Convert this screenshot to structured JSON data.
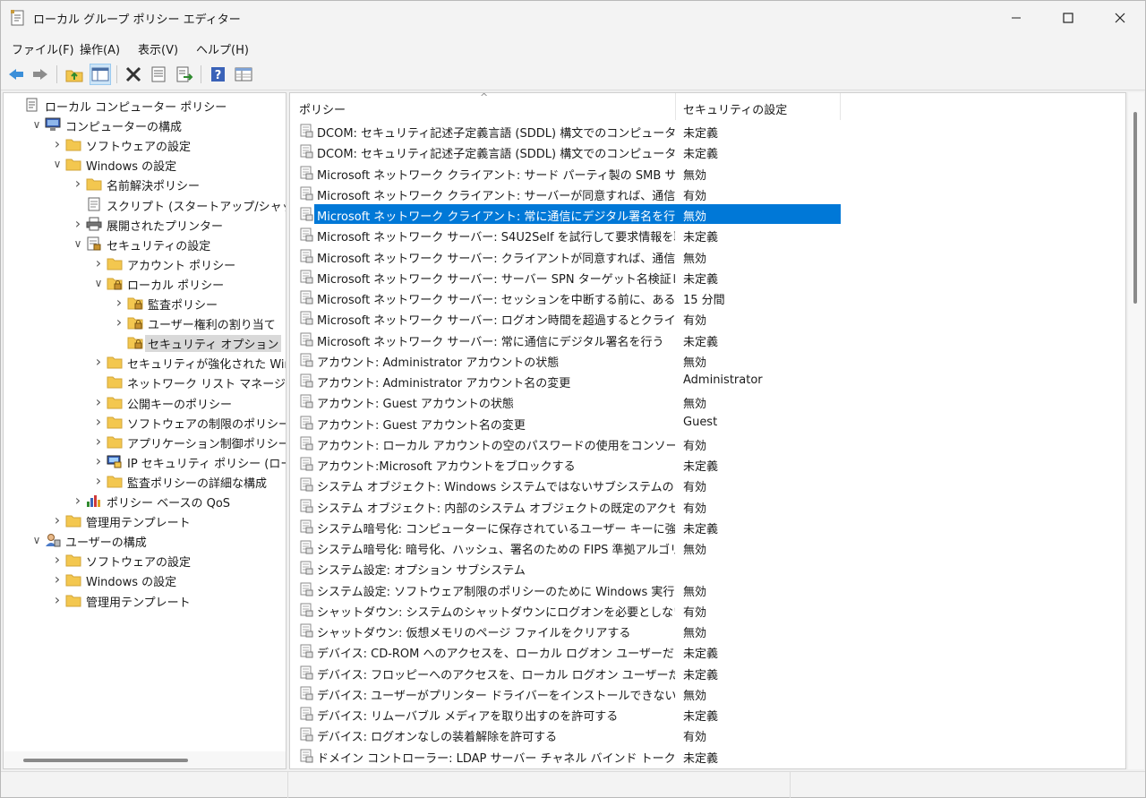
{
  "window": {
    "title": "ローカル グループ ポリシー エディター",
    "app_icon": "policy-editor-icon"
  },
  "menubar": {
    "items": [
      "ファイル(F)",
      "操作(A)",
      "表示(V)",
      "ヘルプ(H)"
    ]
  },
  "toolbar": {
    "buttons": [
      "back-icon",
      "forward-icon",
      "up-folder-icon",
      "show-hide-tree-icon",
      "delete-icon",
      "properties-icon",
      "export-list-icon",
      "help-icon",
      "details-view-icon"
    ]
  },
  "tree": {
    "nodes": [
      {
        "label": "ローカル コンピューター ポリシー",
        "icon": "policy-doc-icon"
      },
      {
        "label": "コンピューターの構成",
        "icon": "computer-icon",
        "expander": "expanded"
      },
      {
        "label": "ソフトウェアの設定",
        "icon": "folder-icon",
        "expander": "collapsed"
      },
      {
        "label": "Windows の設定",
        "icon": "folder-icon",
        "expander": "expanded"
      },
      {
        "label": "名前解決ポリシー",
        "icon": "folder-icon",
        "expander": "collapsed"
      },
      {
        "label": "スクリプト (スタートアップ/シャットダウン)",
        "icon": "script-icon"
      },
      {
        "label": "展開されたプリンター",
        "icon": "printer-icon",
        "expander": "collapsed"
      },
      {
        "label": "セキュリティの設定",
        "icon": "security-settings-icon",
        "expander": "expanded"
      },
      {
        "label": "アカウント ポリシー",
        "icon": "folder-icon",
        "expander": "collapsed"
      },
      {
        "label": "ローカル ポリシー",
        "icon": "locked-folder-icon",
        "expander": "expanded"
      },
      {
        "label": "監査ポリシー",
        "icon": "locked-folder-icon",
        "expander": "collapsed"
      },
      {
        "label": "ユーザー権利の割り当て",
        "icon": "locked-folder-icon",
        "expander": "collapsed"
      },
      {
        "label": "セキュリティ オプション",
        "icon": "locked-folder-icon",
        "selected": true
      },
      {
        "label": "セキュリティが強化された Windows",
        "icon": "folder-icon",
        "expander": "collapsed"
      },
      {
        "label": "ネットワーク リスト マネージャー ポリシ",
        "icon": "folder-icon"
      },
      {
        "label": "公開キーのポリシー",
        "icon": "folder-icon",
        "expander": "collapsed"
      },
      {
        "label": "ソフトウェアの制限のポリシー",
        "icon": "folder-icon",
        "expander": "collapsed"
      },
      {
        "label": "アプリケーション制御ポリシー",
        "icon": "folder-icon",
        "expander": "collapsed"
      },
      {
        "label": "IP セキュリティ ポリシー (ローカル コン",
        "icon": "ip-security-icon",
        "expander": "collapsed"
      },
      {
        "label": "監査ポリシーの詳細な構成",
        "icon": "folder-icon",
        "expander": "collapsed"
      },
      {
        "label": "ポリシー ベースの QoS",
        "icon": "qos-chart-icon",
        "expander": "collapsed"
      },
      {
        "label": "管理用テンプレート",
        "icon": "folder-icon",
        "expander": "collapsed"
      },
      {
        "label": "ユーザーの構成",
        "icon": "user-icon",
        "expander": "expanded"
      },
      {
        "label": "ソフトウェアの設定",
        "icon": "folder-icon",
        "expander": "collapsed"
      },
      {
        "label": "Windows の設定",
        "icon": "folder-icon",
        "expander": "collapsed"
      },
      {
        "label": "管理用テンプレート",
        "icon": "folder-icon",
        "expander": "collapsed"
      }
    ]
  },
  "list": {
    "columns": [
      "ポリシー",
      "セキュリティの設定"
    ],
    "rows": [
      {
        "policy": "DCOM: セキュリティ記述子定義言語 (SDDL) 構文でのコンピューター ...",
        "setting": "未定義"
      },
      {
        "policy": "DCOM: セキュリティ記述子定義言語 (SDDL) 構文でのコンピューター...",
        "setting": "未定義"
      },
      {
        "policy": "Microsoft ネットワーク クライアント: サード パーティ製の SMB サーバーへ...",
        "setting": "無効"
      },
      {
        "policy": "Microsoft ネットワーク クライアント: サーバーが同意すれば、通信にデ...",
        "setting": "有効"
      },
      {
        "policy": "Microsoft ネットワーク クライアント: 常に通信にデジタル署名を行う",
        "setting": "無効",
        "selected": true
      },
      {
        "policy": "Microsoft ネットワーク サーバー: S4U2Self を試行して要求情報を取...",
        "setting": "未定義"
      },
      {
        "policy": "Microsoft ネットワーク サーバー: クライアントが同意すれば、通信にデ...",
        "setting": "無効"
      },
      {
        "policy": "Microsoft ネットワーク サーバー: サーバー SPN ターゲット名検証レベル",
        "setting": "未定義"
      },
      {
        "policy": "Microsoft ネットワーク サーバー: セッションを中断する前に、ある一定...",
        "setting": "15 分間"
      },
      {
        "policy": "Microsoft ネットワーク サーバー: ログオン時間を超過するとクライアン...",
        "setting": "有効"
      },
      {
        "policy": "Microsoft ネットワーク サーバー: 常に通信にデジタル署名を行う",
        "setting": "未定義"
      },
      {
        "policy": "アカウント: Administrator アカウントの状態",
        "setting": "無効"
      },
      {
        "policy": "アカウント: Administrator アカウント名の変更",
        "setting": "Administrator"
      },
      {
        "policy": "アカウント: Guest アカウントの状態",
        "setting": "無効"
      },
      {
        "policy": "アカウント: Guest アカウント名の変更",
        "setting": "Guest"
      },
      {
        "policy": "アカウント: ローカル アカウントの空のパスワードの使用をコンソール ログオ...",
        "setting": "有効"
      },
      {
        "policy": "アカウント:Microsoft アカウントをブロックする",
        "setting": "未定義"
      },
      {
        "policy": "システム オブジェクト: Windows システムではないサブシステムのための...",
        "setting": "有効"
      },
      {
        "policy": "システム オブジェクト: 内部のシステム オブジェクトの既定のアクセス許...",
        "setting": "有効"
      },
      {
        "policy": "システム暗号化: コンピューターに保存されているユーザー キーに強力なキ...",
        "setting": "未定義"
      },
      {
        "policy": "システム暗号化: 暗号化、ハッシュ、署名のための FIPS 準拠アルゴリ...",
        "setting": "無効"
      },
      {
        "policy": "システム設定: オプション サブシステム",
        "setting": ""
      },
      {
        "policy": "システム設定: ソフトウェア制限のポリシーのために Windows 実行可...",
        "setting": "無効"
      },
      {
        "policy": "シャットダウン: システムのシャットダウンにログオンを必要としない",
        "setting": "有効"
      },
      {
        "policy": "シャットダウン: 仮想メモリのページ ファイルをクリアする",
        "setting": "無効"
      },
      {
        "policy": "デバイス: CD-ROM へのアクセスを、ローカル ログオン ユーザーだけに制...",
        "setting": "未定義"
      },
      {
        "policy": "デバイス: フロッピーへのアクセスを、ローカル ログオン ユーザーだけに制限...",
        "setting": "未定義"
      },
      {
        "policy": "デバイス: ユーザーがプリンター ドライバーをインストールできないようにする",
        "setting": "無効"
      },
      {
        "policy": "デバイス: リムーバブル メディアを取り出すのを許可する",
        "setting": "未定義"
      },
      {
        "policy": "デバイス: ログオンなしの装着解除を許可する",
        "setting": "有効"
      },
      {
        "policy": "ドメイン コントローラー: LDAP サーバー チャネル バインド トークンの要件",
        "setting": "未定義"
      }
    ]
  },
  "colors": {
    "selection": "#0078d7",
    "folder": "#f3c74f"
  }
}
